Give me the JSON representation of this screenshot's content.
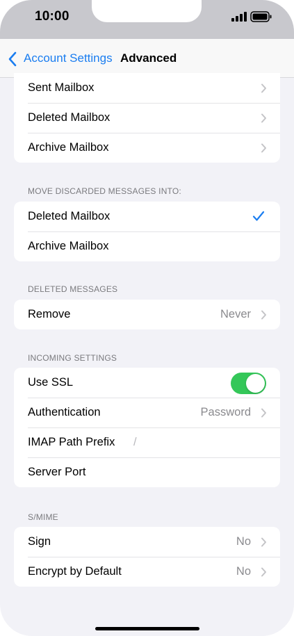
{
  "status_bar": {
    "time": "10:00"
  },
  "nav": {
    "back_label": "Account Settings",
    "title": "Advanced"
  },
  "mailbox_behaviors": {
    "items": [
      {
        "label": "Sent Mailbox"
      },
      {
        "label": "Deleted Mailbox"
      },
      {
        "label": "Archive Mailbox"
      }
    ]
  },
  "move_discarded": {
    "header": "MOVE DISCARDED MESSAGES INTO:",
    "items": [
      {
        "label": "Deleted Mailbox",
        "selected": true
      },
      {
        "label": "Archive Mailbox",
        "selected": false
      }
    ]
  },
  "deleted_messages": {
    "header": "DELETED MESSAGES",
    "remove_label": "Remove",
    "remove_value": "Never"
  },
  "incoming": {
    "header": "INCOMING SETTINGS",
    "use_ssl_label": "Use SSL",
    "use_ssl_on": true,
    "authentication_label": "Authentication",
    "authentication_value": "Password",
    "imap_prefix_label": "IMAP Path Prefix",
    "imap_prefix_value": "/",
    "server_port_label": "Server Port"
  },
  "smime": {
    "header": "S/MIME",
    "sign_label": "Sign",
    "sign_value": "No",
    "encrypt_label": "Encrypt by Default",
    "encrypt_value": "No"
  },
  "colors": {
    "accent": "#1a7df0",
    "toggle_on": "#34c759",
    "background": "#f2f2f7"
  }
}
